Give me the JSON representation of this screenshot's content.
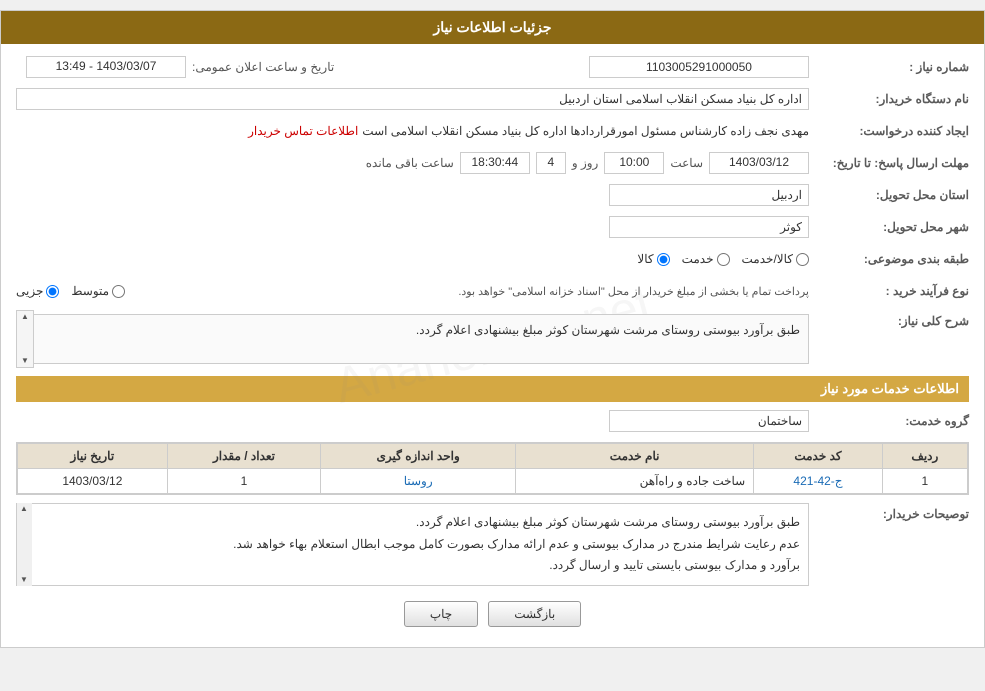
{
  "header": {
    "title": "جزئیات اطلاعات نیاز"
  },
  "fields": {
    "need_number_label": "شماره نیاز :",
    "need_number_value": "1103005291000050",
    "buyer_org_label": "نام دستگاه خریدار:",
    "buyer_org_value": "اداره کل بنیاد مسکن انقلاب اسلامی استان اردبیل",
    "creator_label": "ایجاد کننده درخواست:",
    "creator_name": "مهدی نجف زاده کارشناس مسئول امورقراردادها اداره کل بنیاد مسکن انقلاب اسلامی است",
    "creator_contact": "اطلاعات تماس خریدار",
    "deadline_label": "مهلت ارسال پاسخ: تا تاریخ:",
    "deadline_date": "1403/03/12",
    "deadline_time_label": "ساعت",
    "deadline_time": "10:00",
    "deadline_day_label": "روز و",
    "deadline_days": "4",
    "deadline_remaining_label": "ساعت باقی مانده",
    "deadline_remaining": "18:30:44",
    "province_label": "استان محل تحویل:",
    "province_value": "اردبیل",
    "city_label": "شهر محل تحویل:",
    "city_value": "کوثر",
    "category_label": "طبقه بندی موضوعی:",
    "category_options": [
      "کالا",
      "خدمت",
      "کالا/خدمت"
    ],
    "category_selected": "کالا",
    "process_label": "نوع فرآیند خرید :",
    "process_options": [
      "جزیی",
      "متوسط"
    ],
    "process_note": "پرداخت تمام یا بخشی از مبلغ خریدار از محل \"اسناد خزانه اسلامی\" خواهد بود.",
    "description_label": "شرح کلی نیاز:",
    "description_text": "طبق برآورد بیوستی روستای مرشت شهرستان کوثر مبلغ بیشنهادی اعلام گردد.",
    "pub_date_label": "تاریخ و ساعت اعلان عمومی:",
    "pub_date_value": "1403/03/07 - 13:49",
    "services_section_label": "اطلاعات خدمات مورد نیاز",
    "service_group_label": "گروه خدمت:",
    "service_group_value": "ساختمان",
    "table": {
      "headers": [
        "ردیف",
        "کد خدمت",
        "نام خدمت",
        "واحد اندازه گیری",
        "تعداد / مقدار",
        "تاریخ نیاز"
      ],
      "rows": [
        {
          "row": "1",
          "code": "ج-42-421",
          "service": "ساخت جاده و راه‌آهن",
          "unit": "روستا",
          "quantity": "1",
          "date": "1403/03/12"
        }
      ]
    },
    "buyer_notes_label": "توصیحات خریدار:",
    "buyer_notes": "طبق برآورد بیوستی روستای مرشت شهرستان کوثر مبلغ بیشنهادی اعلام گردد.\nعدم رعایت شرایط مندرج در مدارک بیوستی و عدم ارائه مدارک بصورت کامل موجب ابطال استعلام بهاء خواهد شد.\nبرآورد و مدارک بیوستی بایستی تایید و ارسال گردد.",
    "buttons": {
      "back": "بازگشت",
      "print": "چاپ"
    }
  }
}
